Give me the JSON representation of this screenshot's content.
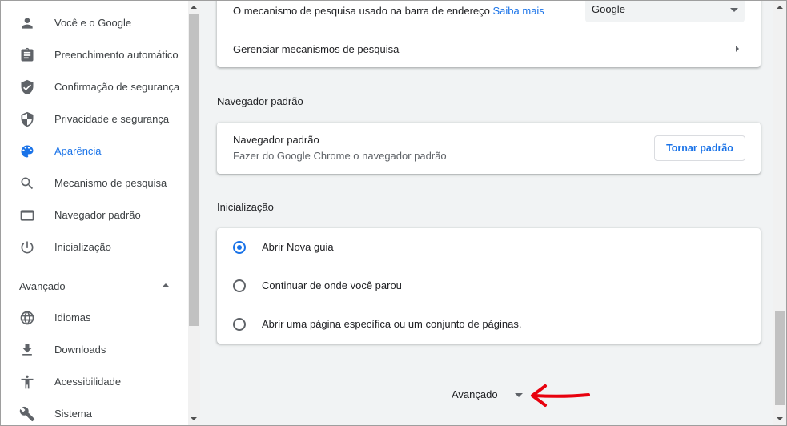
{
  "sidebar": {
    "items": [
      {
        "label": "Você e o Google",
        "icon": "person-icon"
      },
      {
        "label": "Preenchimento automático",
        "icon": "clipboard-icon"
      },
      {
        "label": "Confirmação de segurança",
        "icon": "shield-check-icon"
      },
      {
        "label": "Privacidade e segurança",
        "icon": "shield-half-icon"
      },
      {
        "label": "Aparência",
        "icon": "palette-icon",
        "active": true
      },
      {
        "label": "Mecanismo de pesquisa",
        "icon": "search-icon"
      },
      {
        "label": "Navegador padrão",
        "icon": "browser-window-icon"
      },
      {
        "label": "Inicialização",
        "icon": "power-icon"
      }
    ],
    "advanced_label": "Avançado",
    "advanced_items": [
      {
        "label": "Idiomas",
        "icon": "globe-icon"
      },
      {
        "label": "Downloads",
        "icon": "download-icon"
      },
      {
        "label": "Acessibilidade",
        "icon": "accessibility-icon"
      },
      {
        "label": "Sistema",
        "icon": "wrench-icon"
      }
    ]
  },
  "search_engine": {
    "description": "O mecanismo de pesquisa usado na barra de endereço",
    "learn_more": "Saiba mais",
    "selected": "Google",
    "manage_label": "Gerenciar mecanismos de pesquisa"
  },
  "default_browser": {
    "section_title": "Navegador padrão",
    "title": "Navegador padrão",
    "subtitle": "Fazer do Google Chrome o navegador padrão",
    "button_label": "Tornar padrão"
  },
  "startup": {
    "section_title": "Inicialização",
    "options": [
      {
        "label": "Abrir Nova guia",
        "checked": true
      },
      {
        "label": "Continuar de onde você parou",
        "checked": false
      },
      {
        "label": "Abrir uma página específica ou um conjunto de páginas.",
        "checked": false
      }
    ]
  },
  "advanced_toggle_label": "Avançado",
  "colors": {
    "accent": "#1a73e8",
    "annotation_arrow": "#e8000d"
  }
}
